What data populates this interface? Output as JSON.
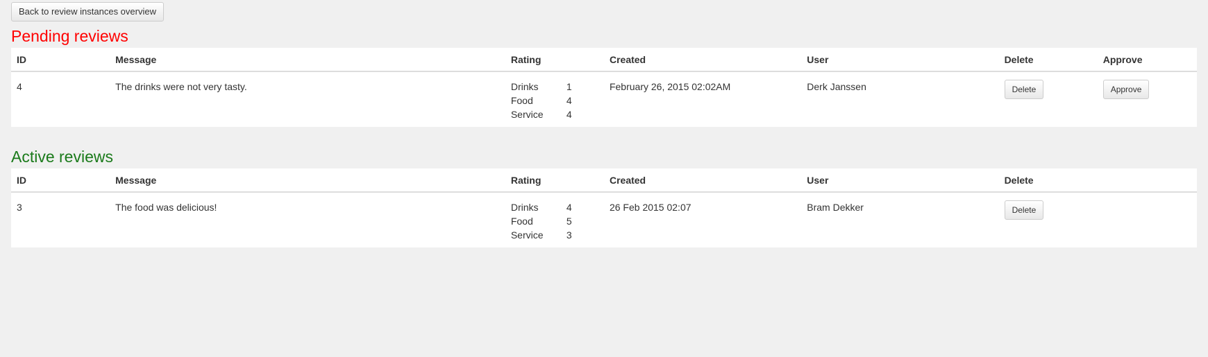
{
  "back_button": {
    "label": "Back to review instances overview"
  },
  "pending": {
    "title": "Pending reviews",
    "title_color": "#ff0000",
    "headers": {
      "id": "ID",
      "message": "Message",
      "rating": "Rating",
      "created": "Created",
      "user": "User",
      "delete": "Delete",
      "approve": "Approve"
    },
    "rows": [
      {
        "id": "4",
        "message": "The drinks were not very tasty.",
        "ratings": [
          {
            "label": "Drinks",
            "value": "1"
          },
          {
            "label": "Food",
            "value": "4"
          },
          {
            "label": "Service",
            "value": "4"
          }
        ],
        "created": "February 26, 2015 02:02AM",
        "user": "Derk Janssen",
        "delete_label": "Delete",
        "approve_label": "Approve"
      }
    ]
  },
  "active": {
    "title": "Active reviews",
    "title_color": "#1a7a1a",
    "headers": {
      "id": "ID",
      "message": "Message",
      "rating": "Rating",
      "created": "Created",
      "user": "User",
      "delete": "Delete"
    },
    "rows": [
      {
        "id": "3",
        "message": "The food was delicious!",
        "ratings": [
          {
            "label": "Drinks",
            "value": "4"
          },
          {
            "label": "Food",
            "value": "5"
          },
          {
            "label": "Service",
            "value": "3"
          }
        ],
        "created": "26 Feb 2015 02:07",
        "user": "Bram Dekker",
        "delete_label": "Delete"
      }
    ]
  }
}
